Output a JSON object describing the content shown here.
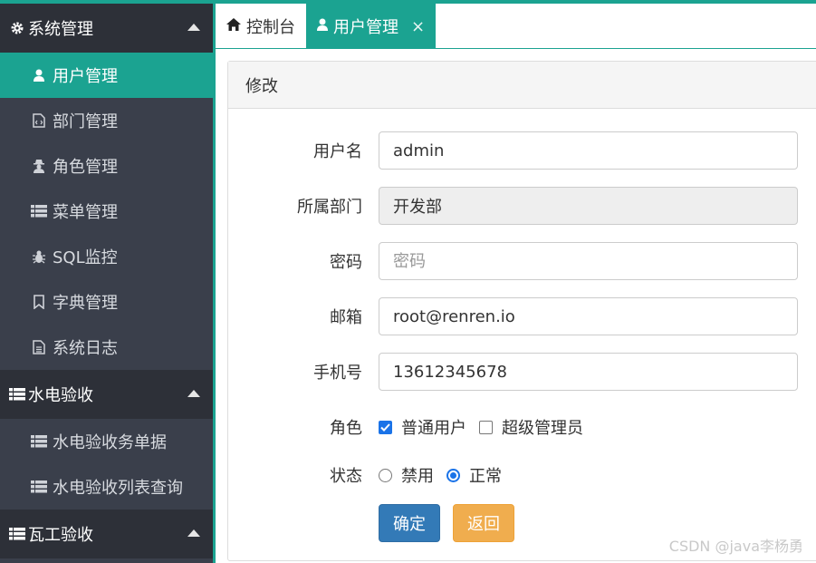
{
  "sidebar": {
    "groups": [
      {
        "label": "系统管理",
        "icon": "gear-icon",
        "items": [
          {
            "label": "用户管理",
            "icon": "user-icon",
            "active": true
          },
          {
            "label": "部门管理",
            "icon": "file-code-icon"
          },
          {
            "label": "角色管理",
            "icon": "user-secret-icon"
          },
          {
            "label": "菜单管理",
            "icon": "list-icon"
          },
          {
            "label": "SQL监控",
            "icon": "bug-icon"
          },
          {
            "label": "字典管理",
            "icon": "bookmark-icon"
          },
          {
            "label": "系统日志",
            "icon": "file-text-icon"
          }
        ]
      },
      {
        "label": "水电验收",
        "icon": "list-icon",
        "items": [
          {
            "label": "水电验收务单据",
            "icon": "list-icon"
          },
          {
            "label": "水电验收列表查询",
            "icon": "list-icon"
          }
        ]
      },
      {
        "label": "瓦工验收",
        "icon": "list-icon",
        "items": []
      }
    ]
  },
  "tabs": [
    {
      "label": "控制台",
      "icon": "home-icon",
      "active": false
    },
    {
      "label": "用户管理",
      "icon": "user-icon",
      "active": true,
      "close": "×"
    }
  ],
  "panel": {
    "title": "修改",
    "fields": {
      "username": {
        "label": "用户名",
        "value": "admin"
      },
      "dept": {
        "label": "所属部门",
        "value": "开发部"
      },
      "password": {
        "label": "密码",
        "placeholder": "密码",
        "value": ""
      },
      "email": {
        "label": "邮箱",
        "value": "root@renren.io"
      },
      "mobile": {
        "label": "手机号",
        "value": "13612345678"
      }
    },
    "roles": {
      "label": "角色",
      "options": [
        {
          "label": "普通用户",
          "checked": true
        },
        {
          "label": "超级管理员",
          "checked": false
        }
      ]
    },
    "status": {
      "label": "状态",
      "options": [
        {
          "label": "禁用",
          "checked": false
        },
        {
          "label": "正常",
          "checked": true
        }
      ]
    },
    "buttons": {
      "confirm": "确定",
      "back": "返回"
    }
  },
  "watermark": "CSDN @java李杨勇",
  "colors": {
    "accent": "#1ba391",
    "sidebar_bg": "#3a3f4b",
    "sidebar_head": "#2d3038",
    "primary": "#337ab7",
    "warning": "#f0ad4e"
  }
}
